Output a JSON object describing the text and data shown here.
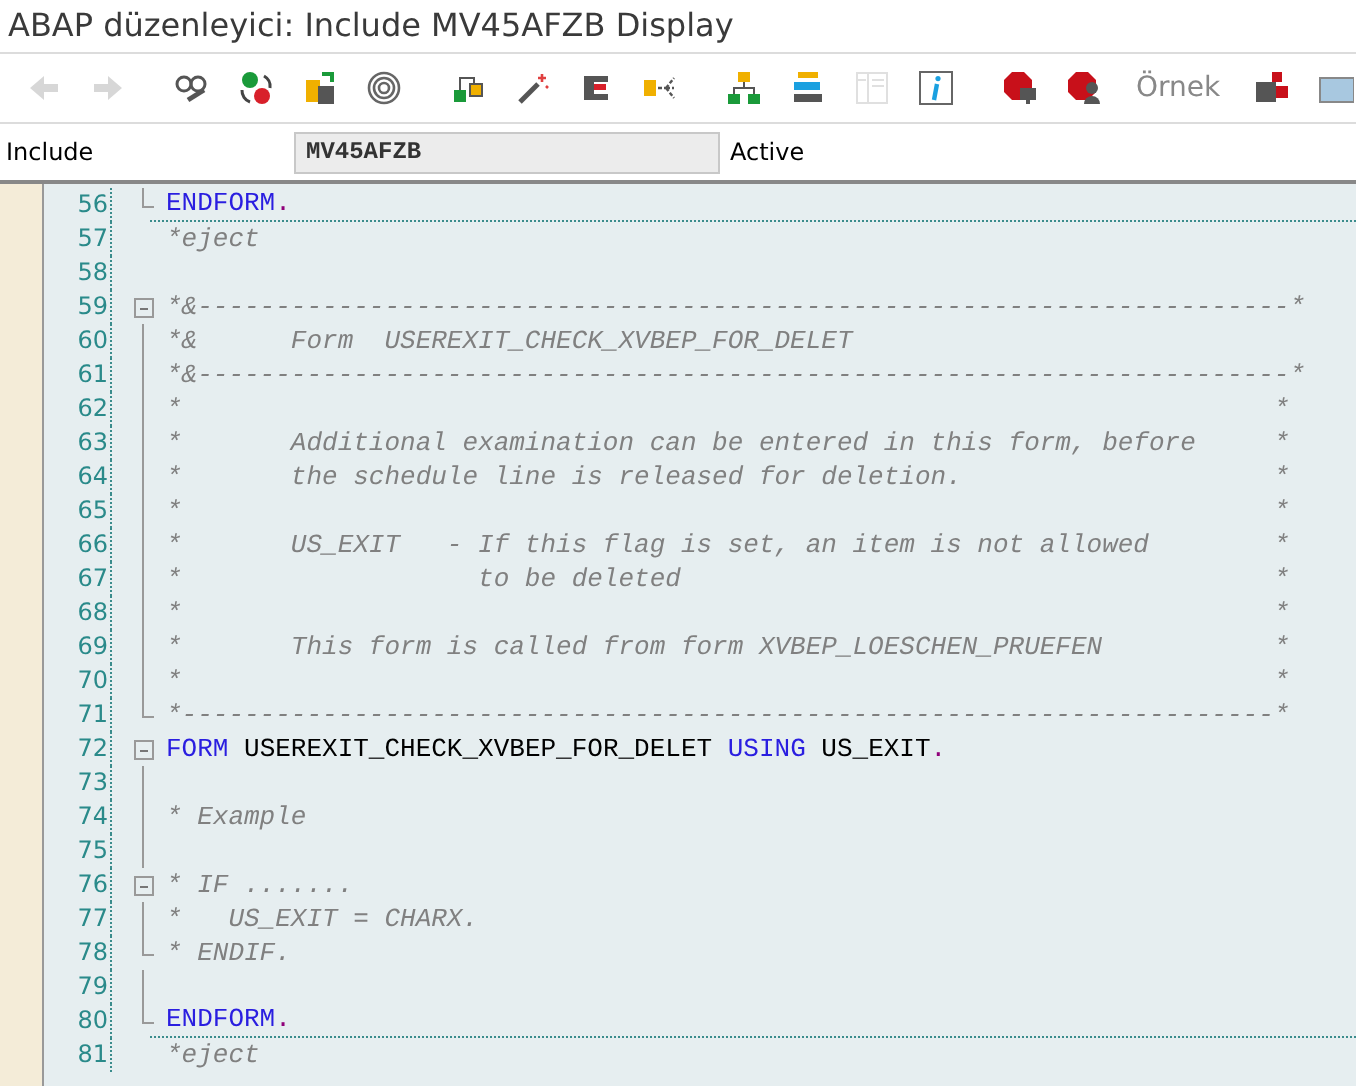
{
  "window": {
    "title": "ABAP düzenleyici: Include MV45AFZB Display"
  },
  "toolbar": [
    {
      "kind": "arrow-left",
      "disabled": true
    },
    {
      "kind": "arrow-right",
      "disabled": true
    },
    {
      "kind": "glasses",
      "disabled": false
    },
    {
      "kind": "dots",
      "disabled": false
    },
    {
      "kind": "swap",
      "disabled": false
    },
    {
      "kind": "rings",
      "disabled": false
    },
    {
      "kind": "tree-small",
      "disabled": false
    },
    {
      "kind": "wand",
      "disabled": false
    },
    {
      "kind": "clamp",
      "disabled": false
    },
    {
      "kind": "branch",
      "disabled": false
    },
    {
      "kind": "hierarchy",
      "disabled": false
    },
    {
      "kind": "stack",
      "disabled": false
    },
    {
      "kind": "panel",
      "disabled": true
    },
    {
      "kind": "info",
      "disabled": false
    },
    {
      "kind": "stop-screen",
      "disabled": false
    },
    {
      "kind": "stop-user",
      "disabled": false
    },
    {
      "kind": "text",
      "label": "Örnek",
      "disabled": true
    },
    {
      "kind": "blocks",
      "disabled": false
    },
    {
      "kind": "window",
      "disabled": false
    }
  ],
  "header": {
    "label": "Include",
    "value": "MV45AFZB",
    "status": "Active"
  },
  "lines": [
    {
      "number": "56",
      "collapsible": false,
      "block_end": true,
      "separator": true,
      "segments": [
        {
          "kind": "keyword",
          "text": "ENDFORM"
        },
        {
          "kind": "punct",
          "text": "."
        }
      ]
    },
    {
      "number": "57",
      "collapsible": false,
      "block_end": false,
      "separator": false,
      "segments": [
        {
          "kind": "comment",
          "text": "*eject"
        }
      ]
    },
    {
      "number": "58",
      "collapsible": false,
      "block_end": false,
      "separator": false
    },
    {
      "number": "59",
      "collapsible": true,
      "block_end": false,
      "separator": false,
      "segments": [
        {
          "kind": "comment",
          "text": "*&----------------------------------------------------------------------*"
        }
      ]
    },
    {
      "number": "60",
      "collapsible": false,
      "block_end": false,
      "separator": false,
      "segments": [
        {
          "kind": "comment",
          "text": "*&      Form  USEREXIT_CHECK_XVBEP_FOR_DELET"
        }
      ]
    },
    {
      "number": "61",
      "collapsible": false,
      "block_end": false,
      "separator": false,
      "segments": [
        {
          "kind": "comment",
          "text": "*&----------------------------------------------------------------------*"
        }
      ]
    },
    {
      "number": "62",
      "collapsible": false,
      "block_end": false,
      "separator": false,
      "segments": [
        {
          "kind": "comment",
          "text": "*                                                                      *"
        }
      ]
    },
    {
      "number": "63",
      "collapsible": false,
      "block_end": false,
      "separator": false,
      "segments": [
        {
          "kind": "comment",
          "text": "*       Additional examination can be entered in this form, before     *"
        }
      ]
    },
    {
      "number": "64",
      "collapsible": false,
      "block_end": false,
      "separator": false,
      "segments": [
        {
          "kind": "comment",
          "text": "*       the schedule line is released for deletion.                    *"
        }
      ]
    },
    {
      "number": "65",
      "collapsible": false,
      "block_end": false,
      "separator": false,
      "segments": [
        {
          "kind": "comment",
          "text": "*                                                                      *"
        }
      ]
    },
    {
      "number": "66",
      "collapsible": false,
      "block_end": false,
      "separator": false,
      "segments": [
        {
          "kind": "comment",
          "text": "*       US_EXIT   - If this flag is set, an item is not allowed        *"
        }
      ]
    },
    {
      "number": "67",
      "collapsible": false,
      "block_end": false,
      "separator": false,
      "segments": [
        {
          "kind": "comment",
          "text": "*                   to be deleted                                      *"
        }
      ]
    },
    {
      "number": "68",
      "collapsible": false,
      "block_end": false,
      "separator": false,
      "segments": [
        {
          "kind": "comment",
          "text": "*                                                                      *"
        }
      ]
    },
    {
      "number": "69",
      "collapsible": false,
      "block_end": false,
      "separator": false,
      "segments": [
        {
          "kind": "comment",
          "text": "*       This form is called from form XVBEP_LOESCHEN_PRUEFEN           *"
        }
      ]
    },
    {
      "number": "70",
      "collapsible": false,
      "block_end": false,
      "separator": false,
      "segments": [
        {
          "kind": "comment",
          "text": "*                                                                      *"
        }
      ]
    },
    {
      "number": "71",
      "collapsible": false,
      "block_end": true,
      "separator": false,
      "segments": [
        {
          "kind": "comment",
          "text": "*----------------------------------------------------------------------*"
        }
      ]
    },
    {
      "number": "72",
      "collapsible": true,
      "block_end": false,
      "separator": false,
      "segments": [
        {
          "kind": "keyword",
          "text": "FORM"
        },
        {
          "kind": "plain",
          "text": " USEREXIT_CHECK_XVBEP_FOR_DELET "
        },
        {
          "kind": "keyword",
          "text": "USING"
        },
        {
          "kind": "plain",
          "text": " US_EXIT"
        },
        {
          "kind": "punct",
          "text": "."
        }
      ]
    },
    {
      "number": "73",
      "collapsible": false,
      "block_end": false,
      "separator": false
    },
    {
      "number": "74",
      "collapsible": false,
      "block_end": false,
      "separator": false,
      "segments": [
        {
          "kind": "comment",
          "text": "* Example"
        }
      ]
    },
    {
      "number": "75",
      "collapsible": false,
      "block_end": false,
      "separator": false
    },
    {
      "number": "76",
      "collapsible": true,
      "block_end": false,
      "separator": false,
      "segments": [
        {
          "kind": "comment",
          "text": "* IF ......."
        }
      ]
    },
    {
      "number": "77",
      "collapsible": false,
      "block_end": false,
      "separator": false,
      "segments": [
        {
          "kind": "comment",
          "text": "*   US_EXIT = CHARX."
        }
      ]
    },
    {
      "number": "78",
      "collapsible": false,
      "block_end": true,
      "separator": false,
      "segments": [
        {
          "kind": "comment",
          "text": "* ENDIF."
        }
      ]
    },
    {
      "number": "79",
      "collapsible": false,
      "block_end": false,
      "separator": false
    },
    {
      "number": "80",
      "collapsible": false,
      "block_end": true,
      "separator": true,
      "segments": [
        {
          "kind": "keyword",
          "text": "ENDFORM"
        },
        {
          "kind": "punct",
          "text": "."
        }
      ]
    },
    {
      "number": "81",
      "collapsible": false,
      "block_end": false,
      "separator": false,
      "segments": [
        {
          "kind": "comment",
          "text": "*eject"
        }
      ]
    }
  ]
}
